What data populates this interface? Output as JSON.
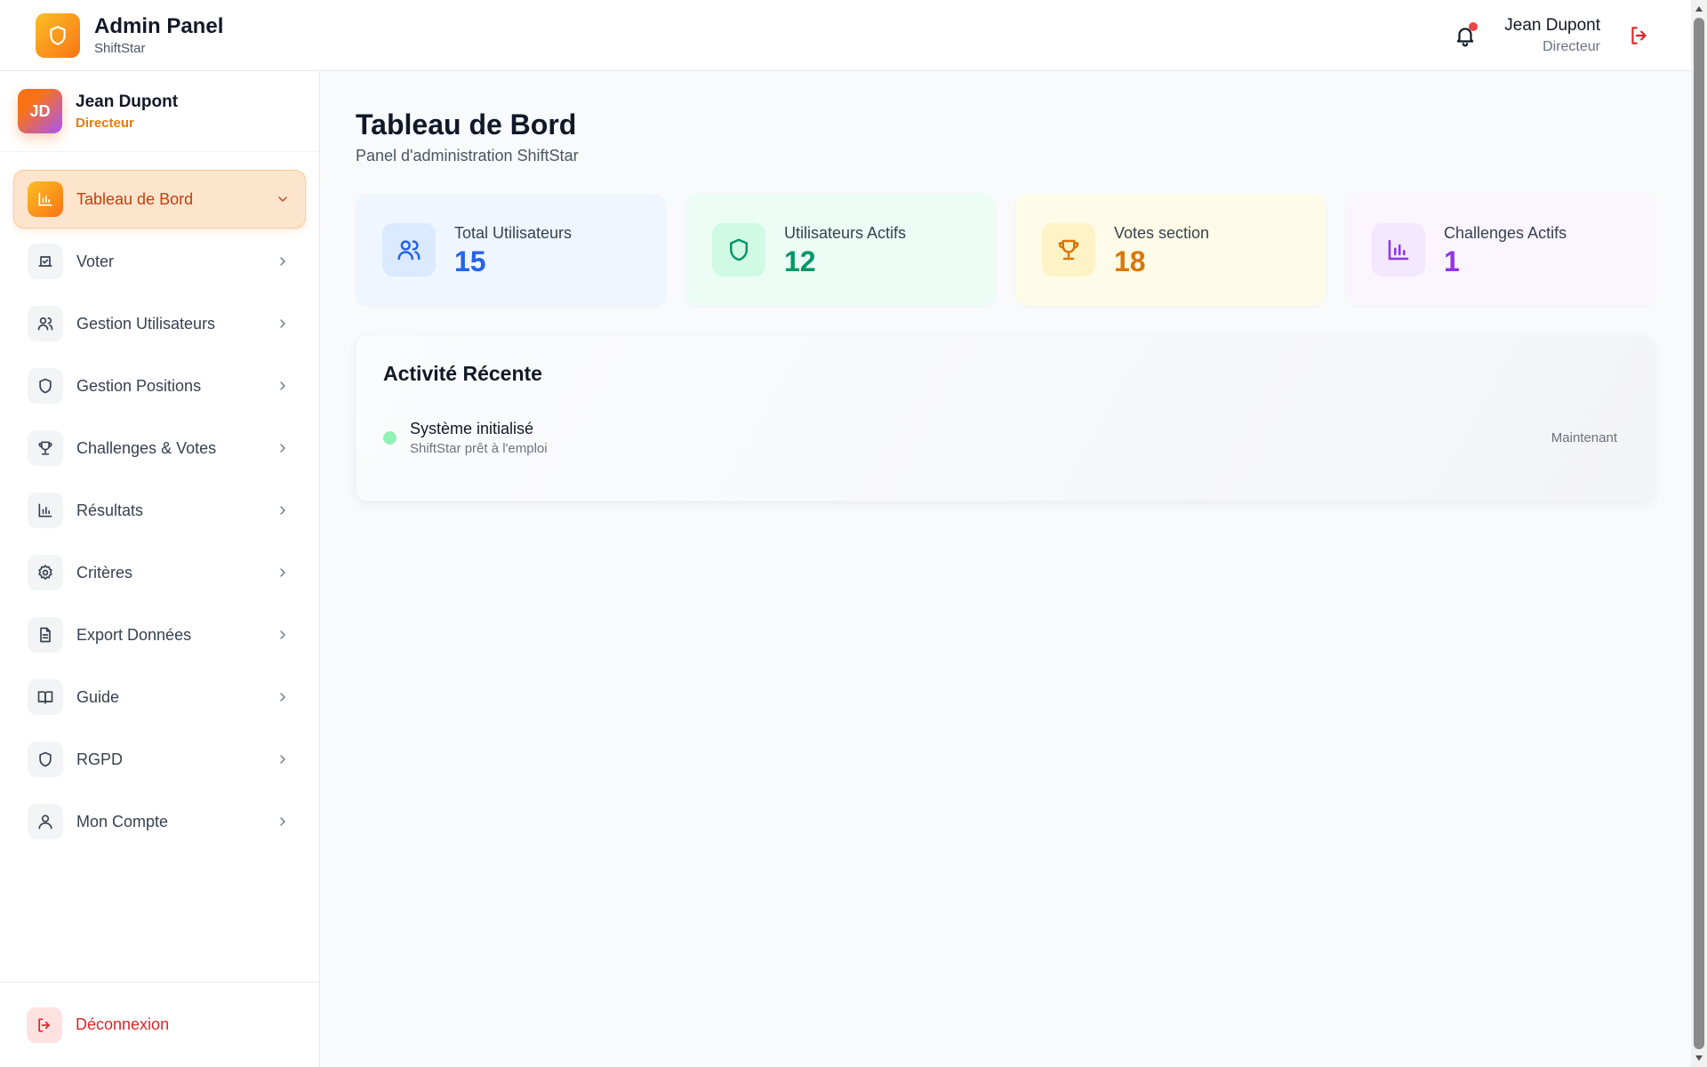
{
  "header": {
    "title": "Admin Panel",
    "subtitle": "ShiftStar",
    "user_name": "Jean Dupont",
    "user_role": "Directeur"
  },
  "sidebar": {
    "user": {
      "initials": "JD",
      "name": "Jean Dupont",
      "role": "Directeur"
    },
    "items": [
      {
        "label": "Tableau de Bord",
        "icon": "bar-chart-icon",
        "active": true
      },
      {
        "label": "Voter",
        "icon": "vote-icon"
      },
      {
        "label": "Gestion Utilisateurs",
        "icon": "users-icon"
      },
      {
        "label": "Gestion Positions",
        "icon": "shield-icon"
      },
      {
        "label": "Challenges & Votes",
        "icon": "trophy-icon"
      },
      {
        "label": "Résultats",
        "icon": "bar-chart-icon"
      },
      {
        "label": "Critères",
        "icon": "gear-icon"
      },
      {
        "label": "Export Données",
        "icon": "file-icon"
      },
      {
        "label": "Guide",
        "icon": "book-icon"
      },
      {
        "label": "RGPD",
        "icon": "shield-icon"
      },
      {
        "label": "Mon Compte",
        "icon": "user-icon"
      }
    ],
    "logout_label": "Déconnexion"
  },
  "main": {
    "title": "Tableau de Bord",
    "subtitle": "Panel d'administration ShiftStar",
    "stats": [
      {
        "label": "Total Utilisateurs",
        "value": "15",
        "icon": "users-icon",
        "color": "#2563eb",
        "bg": "#eff6ff",
        "icon_bg": "#dbeafe"
      },
      {
        "label": "Utilisateurs Actifs",
        "value": "12",
        "icon": "shield-icon",
        "color": "#059669",
        "bg": "#ecfdf5",
        "icon_bg": "#d1fae5"
      },
      {
        "label": "Votes section",
        "value": "18",
        "icon": "trophy-icon",
        "color": "#d97706",
        "bg": "#fefce8",
        "icon_bg": "#fef3c7"
      },
      {
        "label": "Challenges Actifs",
        "value": "1",
        "icon": "bar-chart-icon",
        "color": "#9333ea",
        "bg": "#faf5ff",
        "icon_bg": "#f3e8ff"
      }
    ],
    "activity": {
      "title": "Activité Récente",
      "items": [
        {
          "title": "Système initialisé",
          "subtitle": "ShiftStar prêt à l'emploi",
          "time": "Maintenant"
        }
      ]
    }
  },
  "colors": {
    "accent": "#f97316",
    "danger": "#dc2626"
  }
}
